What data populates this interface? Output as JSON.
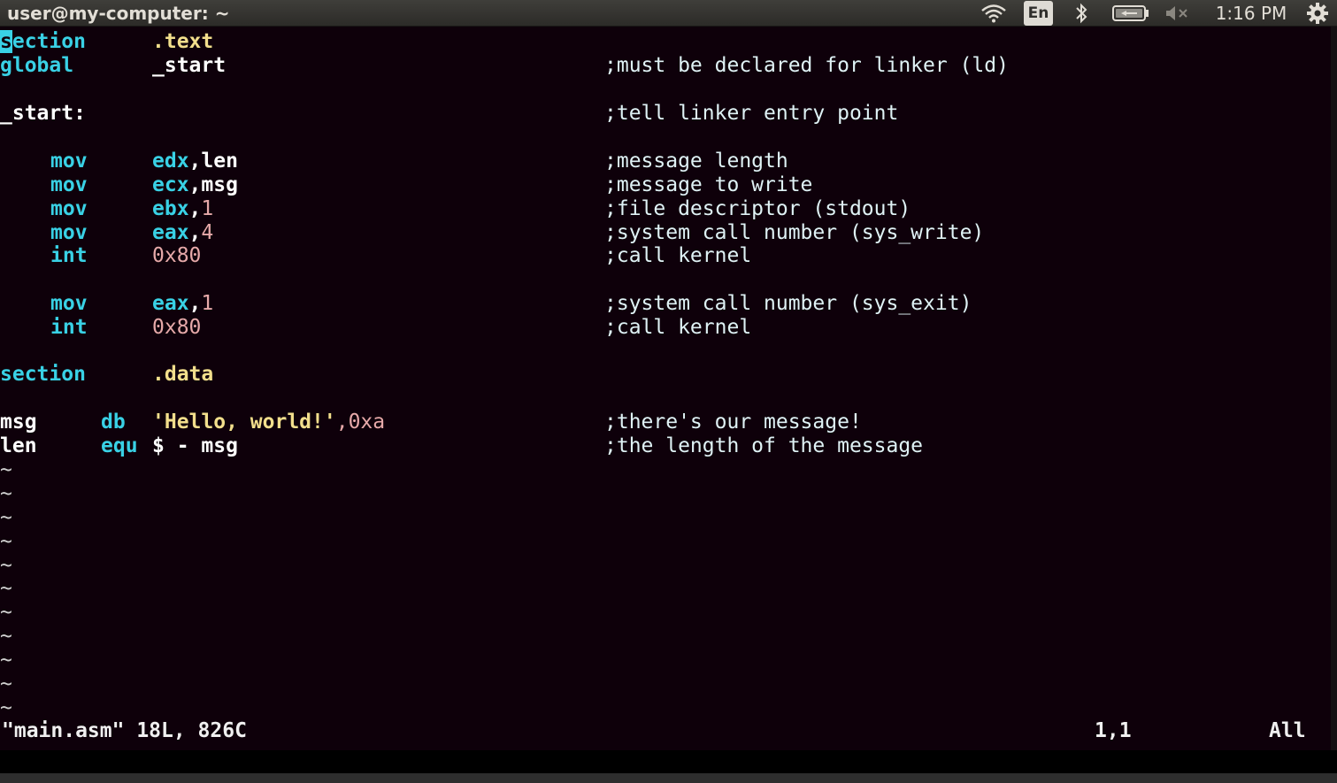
{
  "top_panel": {
    "window_title": "user@my-computer: ~",
    "language_indicator": "En",
    "clock": "1:16 PM",
    "icons": [
      "wifi-icon",
      "bluetooth-icon",
      "battery-icon",
      "volume-muted-icon",
      "gear-icon"
    ]
  },
  "editor": {
    "cursor_char": "s",
    "lines": [
      {
        "col1": "ection",
        "col2": ".text",
        "comment": ""
      },
      {
        "col1": "global",
        "col2": "_start",
        "comment": ";must be declared for linker (ld)"
      },
      {
        "col1": "",
        "col2": "",
        "comment": ""
      },
      {
        "col1": "_start:",
        "col2": "",
        "comment": ";tell linker entry point"
      },
      {
        "col1": "",
        "col2": "",
        "comment": ""
      },
      {
        "op": "mov",
        "reg": "edx",
        "sep": ",",
        "arg": "len",
        "comment": ";message length"
      },
      {
        "op": "mov",
        "reg": "ecx",
        "sep": ",",
        "arg": "msg",
        "comment": ";message to write"
      },
      {
        "op": "mov",
        "reg": "ebx",
        "sep": ",",
        "arg": "1",
        "comment": ";file descriptor (stdout)"
      },
      {
        "op": "mov",
        "reg": "eax",
        "sep": ",",
        "arg": "4",
        "comment": ";system call number (sys_write)"
      },
      {
        "op": "int",
        "reg": "",
        "sep": "",
        "arg": "0x80",
        "comment": ";call kernel"
      },
      {
        "col1": "",
        "col2": "",
        "comment": ""
      },
      {
        "op": "mov",
        "reg": "eax",
        "sep": ",",
        "arg": "1",
        "comment": ";system call number (sys_exit)"
      },
      {
        "op": "int",
        "reg": "",
        "sep": "",
        "arg": "0x80",
        "comment": ";call kernel"
      },
      {
        "col1": "",
        "col2": "",
        "comment": ""
      },
      {
        "col1": "section",
        "col2": ".data",
        "comment": ""
      },
      {
        "col1": "",
        "col2": "",
        "comment": ""
      },
      {
        "label": "msg",
        "directive": "db",
        "str": "'Hello, world!'",
        "rest": ",0xa",
        "comment": ";there's our message!"
      },
      {
        "label": "len",
        "directive": "equ",
        "str": "$ - msg",
        "rest": "",
        "comment": ";the length of the message"
      }
    ],
    "tilde": "~"
  },
  "status_line": {
    "file": "\"main.asm\" 18L, 826C",
    "position": "1,1",
    "scroll": "All"
  },
  "colors": {
    "background": "#0e000a",
    "keyword": "#39d1e5",
    "string": "#f2df8c",
    "number": "#e6a9a9",
    "comment": "#dff2f5"
  }
}
